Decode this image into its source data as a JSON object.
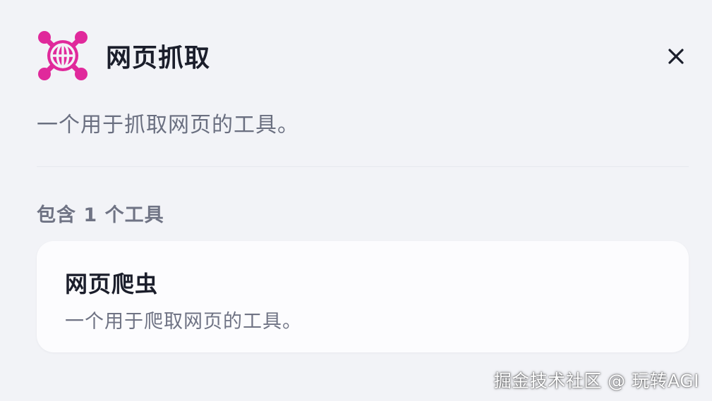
{
  "header": {
    "title": "网页抓取",
    "logo_icon": "globe-network-icon",
    "logo_color": "#e0299b",
    "close_icon": "close-icon"
  },
  "description": "一个用于抓取网页的工具。",
  "tools_section": {
    "count_label": "包含 1 个工具",
    "tools": [
      {
        "name": "网页爬虫",
        "description": "一个用于爬取网页的工具。"
      }
    ]
  },
  "watermark": "掘金技术社区 @ 玩转AGI"
}
